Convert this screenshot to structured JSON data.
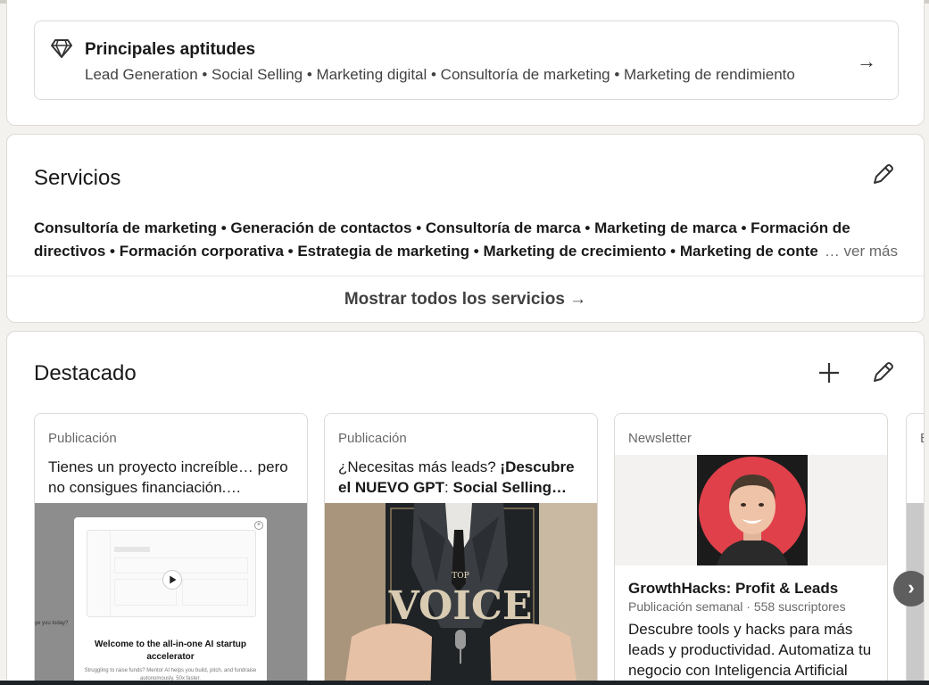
{
  "skills": {
    "title": "Principales aptitudes",
    "list": "Lead Generation • Social Selling • Marketing digital • Consultoría de marketing • Marketing de rendimiento",
    "arrow": "→"
  },
  "services": {
    "title": "Servicios",
    "line1": "Consultoría de marketing • Generación de contactos • Consultoría de marca • Marketing de marca • Formación de",
    "line2": "directivos • Formación corporativa • Estrategia de marketing • Marketing de crecimiento • Marketing de contenidos",
    "see_more": "… ver más",
    "show_all": "Mostrar todos los servicios →"
  },
  "featured": {
    "title": "Destacado",
    "items": [
      {
        "type": "Publicación",
        "text": "Tienes un proyecto increíble… pero no consigues financiación.…",
        "media_title": "Welcome to the all-in-one AI startup accelerator",
        "media_sub": "Struggling to raise funds? Mentor AI helps you build, pitch, and fundraise autonomously. 50x faster.",
        "media_side": "ye you today?"
      },
      {
        "type": "Publicación",
        "text_pre": "¿Necesitas más leads? ",
        "text_bold1": "¡Descubre el NUEVO GPT",
        "text_mid": ": ",
        "text_bold2": "Social Selling…",
        "media_top": "TOP",
        "media_word": "VOICE"
      },
      {
        "type": "Newsletter",
        "title": "GrowthHacks: Profit & Leads",
        "meta": "Publicación semanal · 558 suscriptores",
        "desc": "Descubre tools y hacks para más leads y productividad. Automatiza tu negocio con Inteligencia Artificial"
      }
    ],
    "peek_letter": "E",
    "next": "›"
  },
  "colors": {
    "page_bg": "#f4f2ee",
    "card_bg": "#ffffff",
    "border": "#dedbd6",
    "avatar_ring": "#e0404a"
  }
}
